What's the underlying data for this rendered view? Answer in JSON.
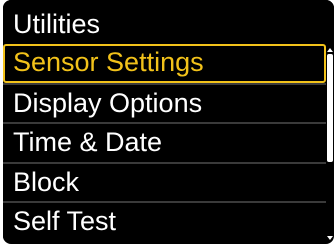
{
  "header": {
    "title": "Utilities"
  },
  "menu": {
    "items": [
      {
        "label": "Sensor Settings",
        "selected": true
      },
      {
        "label": "Display Options",
        "selected": false
      },
      {
        "label": "Time & Date",
        "selected": false
      },
      {
        "label": "Block",
        "selected": false
      },
      {
        "label": "Self Test",
        "selected": false
      }
    ]
  },
  "scrollbar": {
    "up_icon": "scroll-up-arrow-icon",
    "down_icon": "scroll-down-arrow-icon"
  },
  "colors": {
    "background": "#000000",
    "text": "#ffffff",
    "highlight": "#f2c21a",
    "divider": "#3a3a3a"
  }
}
